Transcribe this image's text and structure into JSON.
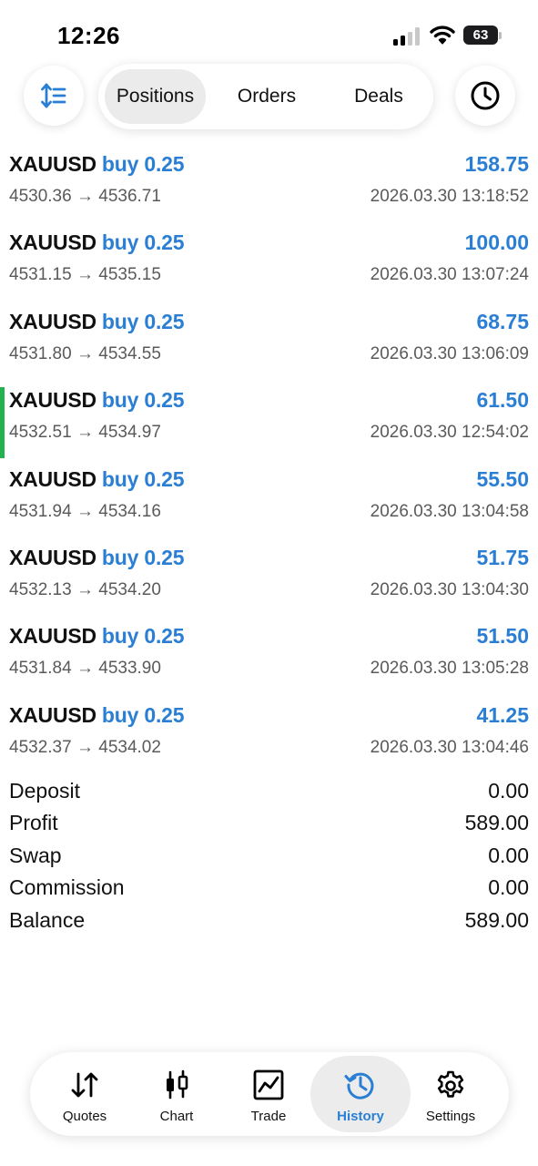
{
  "status_bar": {
    "time": "12:26",
    "battery": "63"
  },
  "segments": {
    "positions": "Positions",
    "orders": "Orders",
    "deals": "Deals",
    "active": "positions"
  },
  "deals": [
    {
      "symbol": "XAUUSD",
      "side": "buy 0.25",
      "profit": "158.75",
      "open": "4530.36",
      "close": "4536.71",
      "arrow": "→",
      "time": "2026.03.30 13:18:52",
      "marked": false
    },
    {
      "symbol": "XAUUSD",
      "side": "buy 0.25",
      "profit": "100.00",
      "open": "4531.15",
      "close": "4535.15",
      "arrow": "→",
      "time": "2026.03.30 13:07:24",
      "marked": false
    },
    {
      "symbol": "XAUUSD",
      "side": "buy 0.25",
      "profit": "68.75",
      "open": "4531.80",
      "close": "4534.55",
      "arrow": "→",
      "time": "2026.03.30 13:06:09",
      "marked": false
    },
    {
      "symbol": "XAUUSD",
      "side": "buy 0.25",
      "profit": "61.50",
      "open": "4532.51",
      "close": "4534.97",
      "arrow": "→",
      "time": "2026.03.30 12:54:02",
      "marked": true
    },
    {
      "symbol": "XAUUSD",
      "side": "buy 0.25",
      "profit": "55.50",
      "open": "4531.94",
      "close": "4534.16",
      "arrow": "→",
      "time": "2026.03.30 13:04:58",
      "marked": false
    },
    {
      "symbol": "XAUUSD",
      "side": "buy 0.25",
      "profit": "51.75",
      "open": "4532.13",
      "close": "4534.20",
      "arrow": "→",
      "time": "2026.03.30 13:04:30",
      "marked": false
    },
    {
      "symbol": "XAUUSD",
      "side": "buy 0.25",
      "profit": "51.50",
      "open": "4531.84",
      "close": "4533.90",
      "arrow": "→",
      "time": "2026.03.30 13:05:28",
      "marked": false
    },
    {
      "symbol": "XAUUSD",
      "side": "buy 0.25",
      "profit": "41.25",
      "open": "4532.37",
      "close": "4534.02",
      "arrow": "→",
      "time": "2026.03.30 13:04:46",
      "marked": false
    }
  ],
  "summary": [
    {
      "label": "Deposit",
      "value": "0.00"
    },
    {
      "label": "Profit",
      "value": "589.00"
    },
    {
      "label": "Swap",
      "value": "0.00"
    },
    {
      "label": "Commission",
      "value": "0.00"
    },
    {
      "label": "Balance",
      "value": "589.00"
    }
  ],
  "tabs": {
    "quotes": "Quotes",
    "chart": "Chart",
    "trade": "Trade",
    "history": "History",
    "settings": "Settings",
    "active": "history"
  },
  "colors": {
    "accent": "#2a7fd4",
    "marker": "#22b14c",
    "secondary_text": "#5a5a5a"
  },
  "icons": {
    "sort": "sort-icon",
    "clock": "clock-icon",
    "quotes": "quotes-arrows-icon",
    "chart": "candlestick-icon",
    "trade": "trade-line-icon",
    "history": "history-icon",
    "settings": "gear-icon"
  }
}
